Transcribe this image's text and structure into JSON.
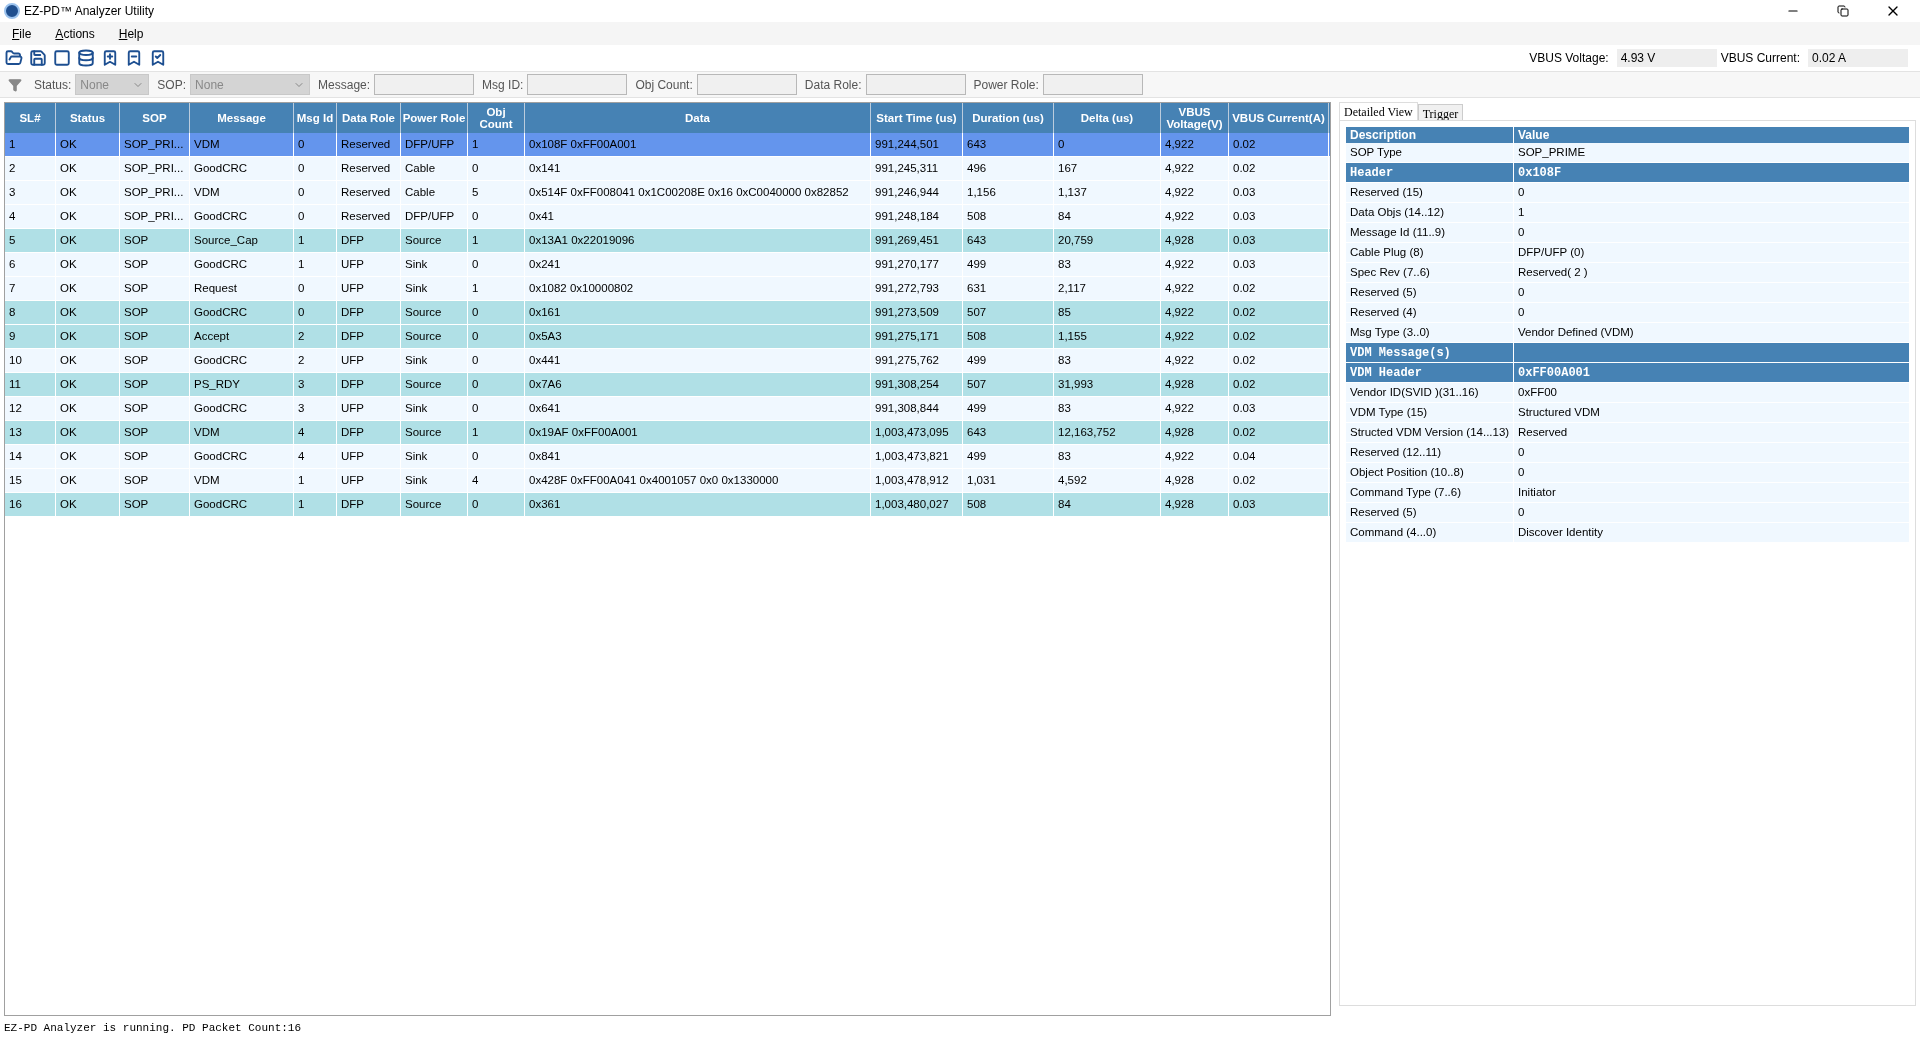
{
  "window": {
    "title": "EZ-PD™ Analyzer Utility"
  },
  "menu": [
    "File",
    "Actions",
    "Help"
  ],
  "vbus": {
    "voltage_label": "VBUS Voltage:",
    "voltage": "4.93 V",
    "current_label": "VBUS Current:",
    "current": "0.02 A"
  },
  "filters": [
    {
      "kind": "combo",
      "label": "Status:",
      "value": "None"
    },
    {
      "kind": "combo",
      "label": "SOP:",
      "value": "None"
    },
    {
      "kind": "text",
      "label": "Message:"
    },
    {
      "kind": "text",
      "label": "Msg ID:"
    },
    {
      "kind": "text",
      "label": "Obj Count:"
    },
    {
      "kind": "text",
      "label": "Data Role:"
    },
    {
      "kind": "text",
      "label": "Power Role:"
    }
  ],
  "table": {
    "columns": [
      "SL#",
      "Status",
      "SOP",
      "Message",
      "Msg Id",
      "Data Role",
      "Power Role",
      "Obj Count",
      "Data",
      "Start Time (us)",
      "Duration (us)",
      "Delta (us)",
      "VBUS Voltage(V)",
      "VBUS Current(A)"
    ],
    "rows": [
      {
        "selected": true,
        "highlighted": false,
        "cells": [
          "1",
          "OK",
          "SOP_PRI...",
          "VDM",
          "0",
          "Reserved",
          "DFP/UFP",
          "1",
          "0x108F 0xFF00A001",
          "991,244,501",
          "643",
          "0",
          "4,922",
          "0.02"
        ]
      },
      {
        "selected": false,
        "highlighted": false,
        "cells": [
          "2",
          "OK",
          "SOP_PRI...",
          "GoodCRC",
          "0",
          "Reserved",
          "Cable",
          "0",
          "0x141",
          "991,245,311",
          "496",
          "167",
          "4,922",
          "0.02"
        ]
      },
      {
        "selected": false,
        "highlighted": false,
        "cells": [
          "3",
          "OK",
          "SOP_PRI...",
          "VDM",
          "0",
          "Reserved",
          "Cable",
          "5",
          "0x514F 0xFF008041 0x1C00208E 0x16 0xC0040000 0x82852",
          "991,246,944",
          "1,156",
          "1,137",
          "4,922",
          "0.03"
        ]
      },
      {
        "selected": false,
        "highlighted": false,
        "cells": [
          "4",
          "OK",
          "SOP_PRI...",
          "GoodCRC",
          "0",
          "Reserved",
          "DFP/UFP",
          "0",
          "0x41",
          "991,248,184",
          "508",
          "84",
          "4,922",
          "0.03"
        ]
      },
      {
        "selected": false,
        "highlighted": true,
        "cells": [
          "5",
          "OK",
          "SOP",
          "Source_Cap",
          "1",
          "DFP",
          "Source",
          "1",
          "0x13A1 0x22019096",
          "991,269,451",
          "643",
          "20,759",
          "4,928",
          "0.03"
        ]
      },
      {
        "selected": false,
        "highlighted": false,
        "cells": [
          "6",
          "OK",
          "SOP",
          "GoodCRC",
          "1",
          "UFP",
          "Sink",
          "0",
          "0x241",
          "991,270,177",
          "499",
          "83",
          "4,922",
          "0.03"
        ]
      },
      {
        "selected": false,
        "highlighted": false,
        "cells": [
          "7",
          "OK",
          "SOP",
          "Request",
          "0",
          "UFP",
          "Sink",
          "1",
          "0x1082 0x10000802",
          "991,272,793",
          "631",
          "2,117",
          "4,922",
          "0.02"
        ]
      },
      {
        "selected": false,
        "highlighted": true,
        "cells": [
          "8",
          "OK",
          "SOP",
          "GoodCRC",
          "0",
          "DFP",
          "Source",
          "0",
          "0x161",
          "991,273,509",
          "507",
          "85",
          "4,922",
          "0.02"
        ]
      },
      {
        "selected": false,
        "highlighted": true,
        "cells": [
          "9",
          "OK",
          "SOP",
          "Accept",
          "2",
          "DFP",
          "Source",
          "0",
          "0x5A3",
          "991,275,171",
          "508",
          "1,155",
          "4,922",
          "0.02"
        ]
      },
      {
        "selected": false,
        "highlighted": false,
        "cells": [
          "10",
          "OK",
          "SOP",
          "GoodCRC",
          "2",
          "UFP",
          "Sink",
          "0",
          "0x441",
          "991,275,762",
          "499",
          "83",
          "4,922",
          "0.02"
        ]
      },
      {
        "selected": false,
        "highlighted": true,
        "cells": [
          "11",
          "OK",
          "SOP",
          "PS_RDY",
          "3",
          "DFP",
          "Source",
          "0",
          "0x7A6",
          "991,308,254",
          "507",
          "31,993",
          "4,928",
          "0.02"
        ]
      },
      {
        "selected": false,
        "highlighted": false,
        "cells": [
          "12",
          "OK",
          "SOP",
          "GoodCRC",
          "3",
          "UFP",
          "Sink",
          "0",
          "0x641",
          "991,308,844",
          "499",
          "83",
          "4,922",
          "0.03"
        ]
      },
      {
        "selected": false,
        "highlighted": true,
        "cells": [
          "13",
          "OK",
          "SOP",
          "VDM",
          "4",
          "DFP",
          "Source",
          "1",
          "0x19AF 0xFF00A001",
          "1,003,473,095",
          "643",
          "12,163,752",
          "4,928",
          "0.02"
        ]
      },
      {
        "selected": false,
        "highlighted": false,
        "cells": [
          "14",
          "OK",
          "SOP",
          "GoodCRC",
          "4",
          "UFP",
          "Sink",
          "0",
          "0x841",
          "1,003,473,821",
          "499",
          "83",
          "4,922",
          "0.04"
        ]
      },
      {
        "selected": false,
        "highlighted": false,
        "cells": [
          "15",
          "OK",
          "SOP",
          "VDM",
          "1",
          "UFP",
          "Sink",
          "4",
          "0x428F 0xFF00A041 0x4001057 0x0 0x1330000",
          "1,003,478,912",
          "1,031",
          "4,592",
          "4,928",
          "0.02"
        ]
      },
      {
        "selected": false,
        "highlighted": true,
        "cells": [
          "16",
          "OK",
          "SOP",
          "GoodCRC",
          "1",
          "DFP",
          "Source",
          "0",
          "0x361",
          "1,003,480,027",
          "508",
          "84",
          "4,928",
          "0.03"
        ]
      }
    ]
  },
  "detail": {
    "tabs": [
      {
        "label": "Detailed View",
        "selected": true
      },
      {
        "label": "Trigger",
        "selected": false
      }
    ],
    "columns": [
      "Description",
      "Value"
    ],
    "rows": [
      {
        "kind": "field",
        "name": "SOP Type",
        "value": "SOP_PRIME"
      },
      {
        "kind": "section",
        "name": "Header",
        "value": "0x108F"
      },
      {
        "kind": "field",
        "name": "Reserved (15)",
        "value": "0"
      },
      {
        "kind": "field",
        "name": "Data Objs (14..12)",
        "value": "1"
      },
      {
        "kind": "field",
        "name": "Message Id (11..9)",
        "value": "0"
      },
      {
        "kind": "field",
        "name": "Cable Plug (8)",
        "value": "DFP/UFP (0)"
      },
      {
        "kind": "field",
        "name": "Spec Rev (7..6)",
        "value": "Reserved( 2 )"
      },
      {
        "kind": "field",
        "name": "Reserved (5)",
        "value": "0"
      },
      {
        "kind": "field",
        "name": "Reserved (4)",
        "value": "0"
      },
      {
        "kind": "field",
        "name": "Msg Type (3..0)",
        "value": "Vendor Defined (VDM)"
      },
      {
        "kind": "section",
        "name": "VDM Message(s)"
      },
      {
        "kind": "section",
        "name": "VDM Header",
        "value": "0xFF00A001"
      },
      {
        "kind": "field",
        "name": "Vendor ID(SVID )(31..16)",
        "value": "0xFF00"
      },
      {
        "kind": "field",
        "name": "VDM Type (15)",
        "value": "Structured VDM"
      },
      {
        "kind": "field",
        "name": "Structed VDM Version (14...13)",
        "value": "Reserved"
      },
      {
        "kind": "field",
        "name": "Reserved (12..11)",
        "value": "0"
      },
      {
        "kind": "field",
        "name": "Object Position (10..8)",
        "value": "0"
      },
      {
        "kind": "field",
        "name": "Command Type (7..6)",
        "value": "Initiator"
      },
      {
        "kind": "field",
        "name": "Reserved (5)",
        "value": "0"
      },
      {
        "kind": "field",
        "name": "Command (4...0)",
        "value": "Discover Identity"
      }
    ]
  },
  "status_bar": "EZ-PD Analyzer is running. PD Packet Count:16"
}
